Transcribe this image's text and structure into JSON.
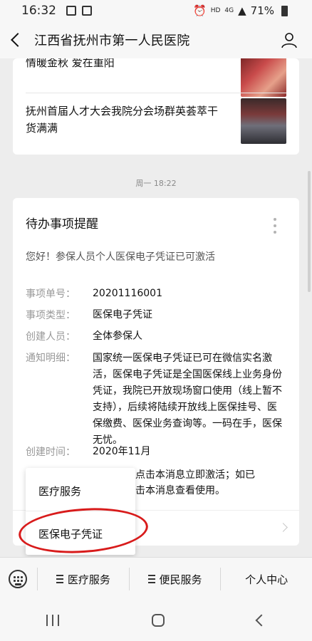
{
  "status_bar": {
    "time": "16:32",
    "network": "HD",
    "signal": "4G",
    "battery": "71%"
  },
  "header": {
    "title": "江西省抚州市第一人民医院"
  },
  "articles": [
    {
      "title": "情暖金秋 爱在重阳"
    },
    {
      "title": "抚州首届人才大会我院分会场群英荟萃干货满满"
    }
  ],
  "timestamp": "周一 18:22",
  "notice": {
    "title": "待办事项提醒",
    "greeting": "您好！参保人员个人医保电子凭证已可激活",
    "fields": [
      {
        "label": "事项单号：",
        "value": "20201116001"
      },
      {
        "label": "事项类型：",
        "value": "医保电子凭证"
      },
      {
        "label": "创建人员：",
        "value": "全体参保人"
      },
      {
        "label": "通知明细：",
        "value": "国家统一医保电子凭证已可在微信实名激活，医保电子凭证是全国医保线上业务身份凭证，我院已开放现场窗口使用（线上暂不支持），后续将陆续开放线上医保挂号、医保缴费、医保业务查询等。一码在手，医保无忧。"
      },
      {
        "label": "创建时间：",
        "value": "2020年11月"
      }
    ],
    "footer_line1": "，点击本消息立即激活；如已",
    "footer_line2": "击本消息查看使用。"
  },
  "popup_menu": {
    "items": [
      {
        "label": "医疗服务"
      },
      {
        "label": "医保电子凭证"
      }
    ]
  },
  "bottom_menu": {
    "items": [
      {
        "label": "医疗服务"
      },
      {
        "label": "便民服务"
      },
      {
        "label": "个人中心"
      }
    ]
  },
  "colors": {
    "annotation": "#d81b1b"
  }
}
